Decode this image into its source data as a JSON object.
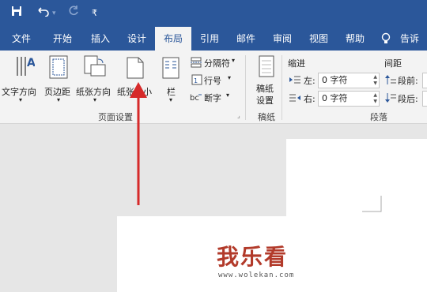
{
  "quick_access": {
    "save_icon": "save-icon",
    "undo_icon": "undo-icon",
    "redo_icon": "redo-icon",
    "customize_label": "₹"
  },
  "tabs": [
    {
      "label": "文件"
    },
    {
      "label": "开始"
    },
    {
      "label": "插入"
    },
    {
      "label": "设计"
    },
    {
      "label": "布局",
      "active": true
    },
    {
      "label": "引用"
    },
    {
      "label": "邮件"
    },
    {
      "label": "审阅"
    },
    {
      "label": "视图"
    },
    {
      "label": "帮助"
    }
  ],
  "tell_me": "告诉我",
  "page_setup": {
    "text_direction": "文字方向",
    "margins": "页边距",
    "orientation": "纸张方向",
    "size": "纸张大小",
    "columns": "栏",
    "breaks": "分隔符",
    "line_numbers": "行号",
    "hyphenation": "断字",
    "group_label": "页面设置"
  },
  "manuscript": {
    "button": "稿纸设置",
    "button_line1": "稿纸",
    "button_line2": "设置",
    "group_label": "稿纸"
  },
  "paragraph": {
    "indent_title": "缩进",
    "spacing_title": "间距",
    "left_label": "左:",
    "left_value": "0 字符",
    "right_label": "右:",
    "right_value": "0 字符",
    "before_label": "段前:",
    "after_label": "段后:",
    "group_label": "段落"
  },
  "watermark": {
    "text": "我乐看",
    "url": "www.wolekan.com"
  },
  "colors": {
    "brand": "#2b579a",
    "arrow": "#d62a2a"
  }
}
